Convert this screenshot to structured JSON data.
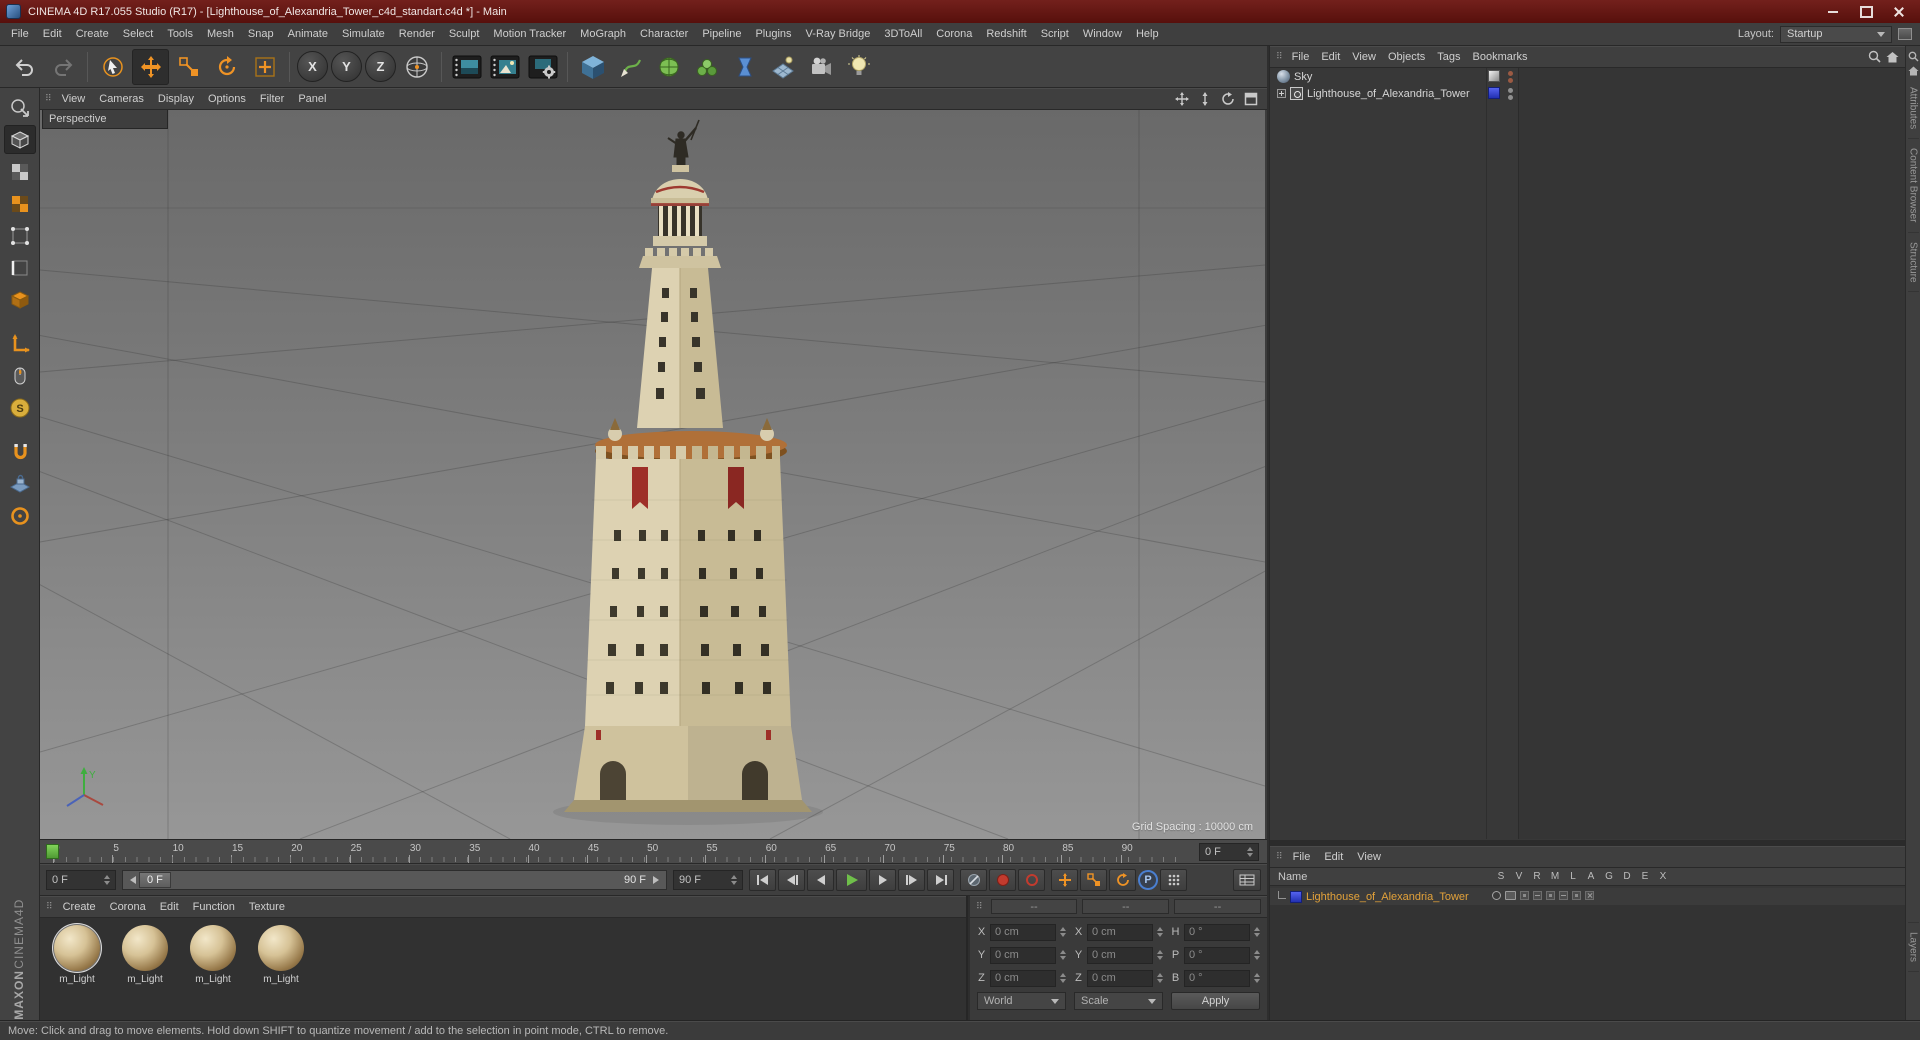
{
  "window": {
    "title": "CINEMA 4D R17.055 Studio (R17) - [Lighthouse_of_Alexandria_Tower_c4d_standart.c4d *] - Main"
  },
  "menu_bar": {
    "items": [
      "File",
      "Edit",
      "Create",
      "Select",
      "Tools",
      "Mesh",
      "Snap",
      "Animate",
      "Simulate",
      "Render",
      "Sculpt",
      "Motion Tracker",
      "MoGraph",
      "Character",
      "Pipeline",
      "Plugins",
      "V-Ray Bridge",
      "3DToAll",
      "Corona",
      "Redshift",
      "Script",
      "Window",
      "Help"
    ],
    "layout_label": "Layout:",
    "layout_value": "Startup"
  },
  "toolbar": {
    "axis_x": "X",
    "axis_y": "Y",
    "axis_z": "Z"
  },
  "palette": {
    "solo_glyph": "S"
  },
  "viewport": {
    "menu": [
      "View",
      "Cameras",
      "Display",
      "Options",
      "Filter",
      "Panel"
    ],
    "view_label": "Perspective",
    "grid_spacing": "Grid Spacing : 10000 cm",
    "axis_y_label": "Y"
  },
  "object_manager": {
    "menu": [
      "File",
      "Edit",
      "View",
      "Objects",
      "Tags",
      "Bookmarks"
    ],
    "items": [
      {
        "name": "Sky"
      },
      {
        "name": "Lighthouse_of_Alexandria_Tower"
      }
    ]
  },
  "timeline": {
    "ticks": [
      "0",
      "5",
      "10",
      "15",
      "20",
      "25",
      "30",
      "35",
      "40",
      "45",
      "50",
      "55",
      "60",
      "65",
      "70",
      "75",
      "80",
      "85",
      "90"
    ],
    "ruler_field": "0 F",
    "start_field": "0 F",
    "scrub_current": "0 F",
    "scrub_end": "90 F",
    "end_field": "90 F",
    "param_label": "P"
  },
  "materials": {
    "menu": [
      "Create",
      "Corona",
      "Edit",
      "Function",
      "Texture"
    ],
    "items": [
      "m_Light",
      "m_Light",
      "m_Light",
      "m_Light"
    ]
  },
  "coordinates": {
    "headers": [
      "--",
      "--",
      "--"
    ],
    "rows": [
      {
        "a_label": "X",
        "a_value": "0 cm",
        "b_label": "X",
        "b_value": "0 cm",
        "c_label": "H",
        "c_value": "0 °"
      },
      {
        "a_label": "Y",
        "a_value": "0 cm",
        "b_label": "Y",
        "b_value": "0 cm",
        "c_label": "P",
        "c_value": "0 °"
      },
      {
        "a_label": "Z",
        "a_value": "0 cm",
        "b_label": "Z",
        "b_value": "0 cm",
        "c_label": "B",
        "c_value": "0 °"
      }
    ],
    "world_label": "World",
    "scale_label": "Scale",
    "apply_label": "Apply"
  },
  "lower_panel": {
    "menu": [
      "File",
      "Edit",
      "View"
    ],
    "name_header": "Name",
    "columns": [
      "S",
      "V",
      "R",
      "M",
      "L",
      "A",
      "G",
      "D",
      "E",
      "X"
    ],
    "item_name": "Lighthouse_of_Alexandria_Tower"
  },
  "right_edge": {
    "tabs_top": [
      "Attributes",
      "Content Browser",
      "Structure"
    ],
    "tabs_bottom": [
      "Layers"
    ]
  },
  "branding": {
    "line1": "MAXON",
    "line2": "CINEMA4D"
  },
  "status_bar": {
    "text": "Move: Click and drag to move elements. Hold down SHIFT to quantize movement / add to the selection in point mode, CTRL to remove."
  },
  "icons": {
    "grip": "⠿"
  }
}
